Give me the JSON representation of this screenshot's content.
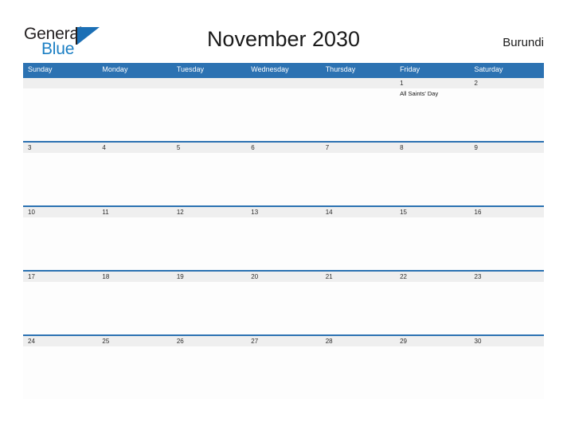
{
  "logo": {
    "word_one": "General",
    "word_two": "Blue",
    "flag_icon": "blue-flag-triangle",
    "accent_color": "#1b7fc4"
  },
  "header": {
    "title": "November 2030",
    "region": "Burundi"
  },
  "theme": {
    "header_bar": "#2c72b2",
    "date_band": "#efefef",
    "text_dark": "#1a1a1a",
    "page_background": "#ffffff"
  },
  "calendar": {
    "month": "November",
    "year": "2030",
    "weekday_headers": [
      "Sunday",
      "Monday",
      "Tuesday",
      "Wednesday",
      "Thursday",
      "Friday",
      "Saturday"
    ],
    "weeks": [
      {
        "days": [
          {
            "date": "",
            "events": []
          },
          {
            "date": "",
            "events": []
          },
          {
            "date": "",
            "events": []
          },
          {
            "date": "",
            "events": []
          },
          {
            "date": "",
            "events": []
          },
          {
            "date": "1",
            "events": [
              "All Saints' Day"
            ]
          },
          {
            "date": "2",
            "events": []
          }
        ]
      },
      {
        "days": [
          {
            "date": "3",
            "events": []
          },
          {
            "date": "4",
            "events": []
          },
          {
            "date": "5",
            "events": []
          },
          {
            "date": "6",
            "events": []
          },
          {
            "date": "7",
            "events": []
          },
          {
            "date": "8",
            "events": []
          },
          {
            "date": "9",
            "events": []
          }
        ]
      },
      {
        "days": [
          {
            "date": "10",
            "events": []
          },
          {
            "date": "11",
            "events": []
          },
          {
            "date": "12",
            "events": []
          },
          {
            "date": "13",
            "events": []
          },
          {
            "date": "14",
            "events": []
          },
          {
            "date": "15",
            "events": []
          },
          {
            "date": "16",
            "events": []
          }
        ]
      },
      {
        "days": [
          {
            "date": "17",
            "events": []
          },
          {
            "date": "18",
            "events": []
          },
          {
            "date": "19",
            "events": []
          },
          {
            "date": "20",
            "events": []
          },
          {
            "date": "21",
            "events": []
          },
          {
            "date": "22",
            "events": []
          },
          {
            "date": "23",
            "events": []
          }
        ]
      },
      {
        "days": [
          {
            "date": "24",
            "events": []
          },
          {
            "date": "25",
            "events": []
          },
          {
            "date": "26",
            "events": []
          },
          {
            "date": "27",
            "events": []
          },
          {
            "date": "28",
            "events": []
          },
          {
            "date": "29",
            "events": []
          },
          {
            "date": "30",
            "events": []
          }
        ]
      }
    ]
  }
}
